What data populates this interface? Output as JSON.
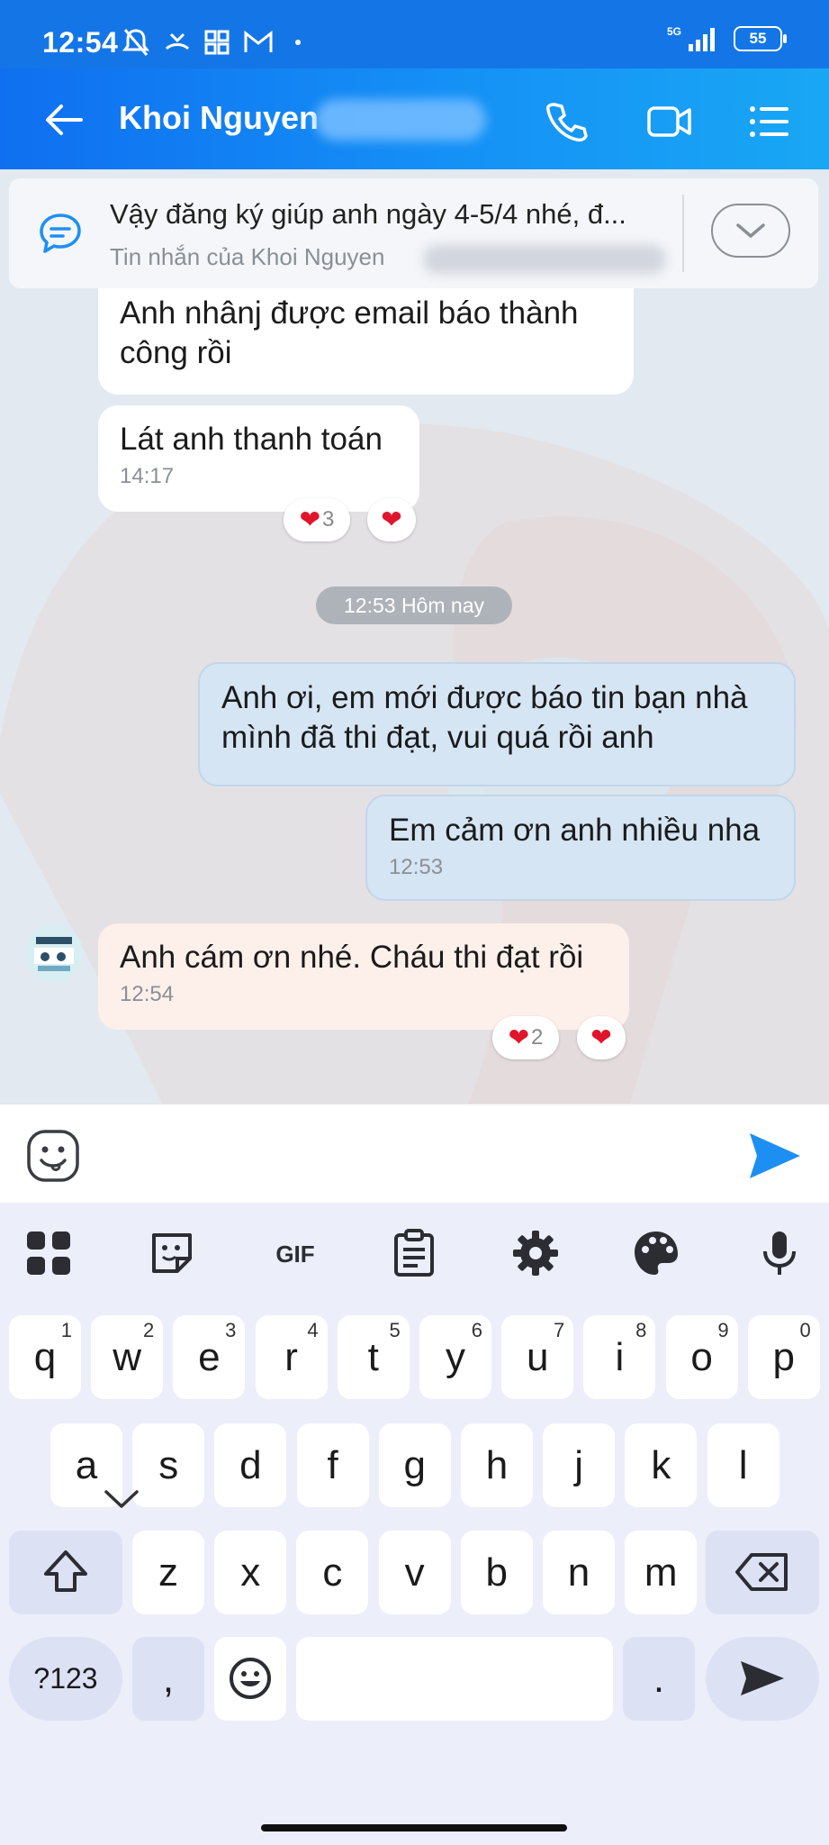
{
  "status_bar": {
    "time": "12:54",
    "network": "5G",
    "battery": "55"
  },
  "header": {
    "contact_name": "Khoi Nguyen"
  },
  "pinned": {
    "text": "Vậy đăng ký giúp anh ngày 4-5/4 nhé, đ...",
    "source": "Tin nhắn của Khoi Nguyen"
  },
  "messages": [
    {
      "text": "Anh nhânj được email báo thành công rồi"
    },
    {
      "text": "Lát anh thanh toán",
      "time": "14:17",
      "reaction_count": "3"
    },
    {
      "date_separator": "12:53 Hôm nay"
    },
    {
      "text": "Anh ơi, em mới được báo tin bạn nhà mình đã thi đạt, vui quá rồi anh"
    },
    {
      "text": "Em cảm ơn anh nhiều nha",
      "time": "12:53"
    },
    {
      "text": "Anh cám ơn nhé. Cháu thi đạt rồi",
      "time": "12:54",
      "reaction_count": "2"
    }
  ],
  "keyboard": {
    "toolbar": [
      "apps-icon",
      "sticker-icon",
      "GIF",
      "clipboard-icon",
      "settings-icon",
      "palette-icon",
      "mic-icon"
    ],
    "row1": [
      {
        "k": "q",
        "n": "1"
      },
      {
        "k": "w",
        "n": "2"
      },
      {
        "k": "e",
        "n": "3"
      },
      {
        "k": "r",
        "n": "4"
      },
      {
        "k": "t",
        "n": "5"
      },
      {
        "k": "y",
        "n": "6"
      },
      {
        "k": "u",
        "n": "7"
      },
      {
        "k": "i",
        "n": "8"
      },
      {
        "k": "o",
        "n": "9"
      },
      {
        "k": "p",
        "n": "0"
      }
    ],
    "row2": [
      "a",
      "s",
      "d",
      "f",
      "g",
      "h",
      "j",
      "k",
      "l"
    ],
    "row3": [
      "z",
      "x",
      "c",
      "v",
      "b",
      "n",
      "m"
    ],
    "row4": {
      "symbols": "?123",
      "comma": ",",
      "period": "."
    }
  },
  "colors": {
    "header": "#1476e6",
    "accent": "#1e8ff2",
    "heart": "#e0152b"
  }
}
